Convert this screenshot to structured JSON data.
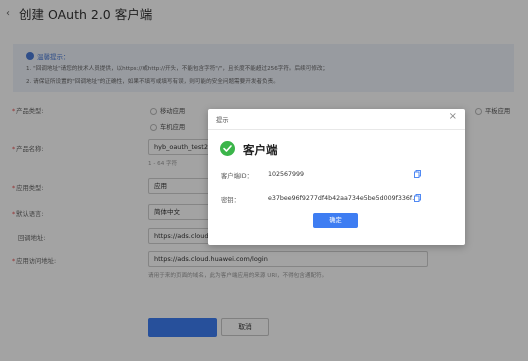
{
  "header": {
    "title": "创建 OAuth 2.0 客户端"
  },
  "notice": {
    "title": "温馨提示：",
    "line1": "1. \"回调地址\"请您的技术人员提供，以https://或http://开头，不能包含字符\"/\"，且长度不能超过256字符。后续可修改；",
    "line2": "2. 请保证所设置的\"回调地址\"的正确性，如果不填写或填写有误，则可能的安全问题需要开发者负责。"
  },
  "form": {
    "client_type": {
      "label": "产品类型:",
      "options": [
        "移动应用",
        "车机应用",
        "平板应用"
      ]
    },
    "product_name": {
      "label": "产品名称:",
      "value": "hyb_oauth_test2",
      "hint": "1 - 64 字符"
    },
    "app_type": {
      "label": "应用类型:",
      "value": "应用"
    },
    "default_language": {
      "label": "默认语言:",
      "value": "简体中文"
    },
    "callback_url": {
      "label": "回调地址:",
      "value": "https://ads.cloud.h"
    },
    "app_access_url": {
      "label": "应用访问地址:",
      "value": "https://ads.cloud.huawei.com/login",
      "hint": "请用于来的页面的域名，此为客户端应用的来源 URI，不得包含通配符。"
    },
    "submit_label": "",
    "cancel_label": "取消"
  },
  "dialog": {
    "title": "提示",
    "success_title": "客户端",
    "client_id_label": "客户端ID：",
    "client_id_value": "102567999",
    "secret_label": "密钥：",
    "secret_value": "e37bee96f9277df4b42aa734e5be5d009f336f…",
    "confirm_label": "确定"
  },
  "colors": {
    "accent": "#3e7df2",
    "success": "#3bb54a",
    "notice_bg": "#eef2fb",
    "required": "#e64b4b"
  }
}
